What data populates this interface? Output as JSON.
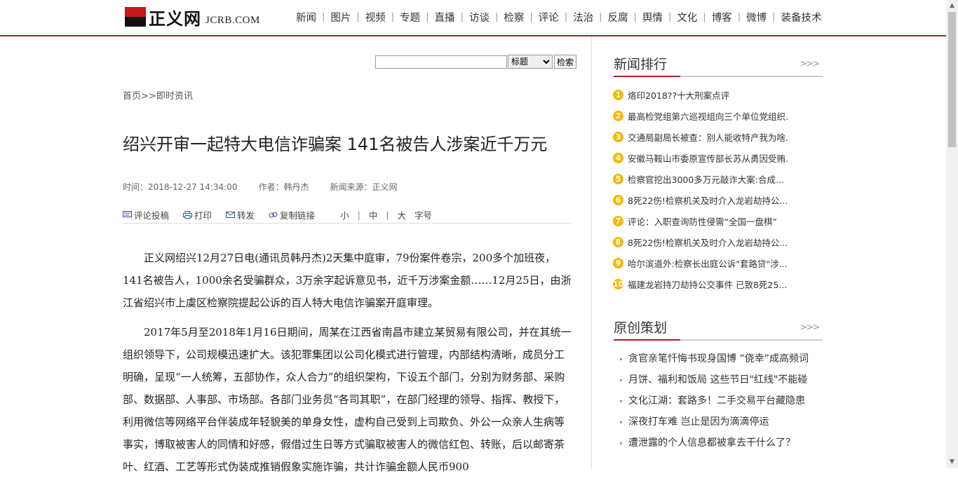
{
  "header": {
    "logo_cn": "正义网",
    "logo_en": "JCRB.COM",
    "nav": [
      "新闻",
      "图片",
      "视频",
      "专题",
      "直播",
      "访谈",
      "检察",
      "评论",
      "法治",
      "反腐",
      "舆情",
      "文化",
      "博客",
      "微博",
      "装备技术"
    ]
  },
  "search": {
    "input_value": "",
    "select_value": "标题",
    "button_label": "检索"
  },
  "breadcrumb": {
    "home": "首页",
    "sep": ">>",
    "current": "即时资讯"
  },
  "article": {
    "title": "绍兴开审一起特大电信诈骗案 141名被告人涉案近千万元",
    "time": "时间：2018-12-27 14:34:00",
    "author": "作者：韩丹杰",
    "source": "新闻来源：正义网",
    "tools": {
      "comment": "评论投稿",
      "print": "打印",
      "forward": "转发",
      "copy_link": "复制链接",
      "small": "小",
      "medium": "中",
      "large": "大",
      "font_size": "字号"
    },
    "paragraphs": [
      "正义网绍兴12月27日电(通讯员韩丹杰)2天集中庭审，79份案件卷宗，200多个加班夜，141名被告人，1000余名受骗群众，3万余字起诉意见书，近千万涉案金额……12月25日，由浙江省绍兴市上虞区检察院提起公诉的百人特大电信诈骗案开庭审理。",
      "2017年5月至2018年1月16日期间，周某在江西省南昌市建立某贸易有限公司，并在其统一组织领导下，公司规模迅速扩大。该犯罪集团以公司化模式进行管理，内部结构清晰，成员分工明确，呈现“一人统筹，五部协作，众人合力”的组织架构，下设五个部门，分别为财务部、采购部、数据部、人事部、市场部。各部门业务员“各司其职”，在部门经理的领导、指挥、教授下，利用微信等网络平台伴装成年轻貌美的单身女性，虚构自己受到上司欺负、外公一众亲人生病等事实，博取被害人的同情和好感，假借过生日等方式骗取被害人的微信红包、转账，后以邮寄茶叶、红酒、工艺等形式伪装成推销假象实施诈骗，共计诈骗金额人民币900"
    ]
  },
  "sidebar": {
    "rank_title": "新闻排行",
    "more": ">>>",
    "rank_items": [
      {
        "num": "1",
        "text": "烙印2018??十大刑案点评"
      },
      {
        "num": "2",
        "text": "最高检党组第六巡视组向三个单位党组织."
      },
      {
        "num": "3",
        "text": "交通局副局长被查：别人能收特产我为啥."
      },
      {
        "num": "4",
        "text": "安徽马鞍山市委原宣传部长苏从勇因受贿."
      },
      {
        "num": "5",
        "text": "检察官挖出3000多万元敲诈大案:合成..."
      },
      {
        "num": "6",
        "text": "8死22伤!检察机关及时介入龙岩劫持公..."
      },
      {
        "num": "7",
        "text": "评论：入职查询防性侵需“全国一盘棋”"
      },
      {
        "num": "8",
        "text": "8死22伤!检察机关及时介入龙岩劫持公..."
      },
      {
        "num": "9",
        "text": "哈尔滨道外:检察长出庭公诉\"套路贷\"涉..."
      },
      {
        "num": "10",
        "text": "福建龙岩持刀劫持公交事件 已致8死25..."
      }
    ],
    "orig_title": "原创策划",
    "orig_items": [
      "贪官亲笔忏悔书现身国博 “侥幸”成高频词",
      "月饼、福利和饭局 这些节日\"红线\"不能碰",
      "文化江湖：套路多！二手交易平台藏隐患",
      "深夜打车难 岂止是因为滴滴停运",
      "遭泄露的个人信息都被拿去干什么了？"
    ]
  },
  "colors": {
    "accent_red": "#b22222",
    "rank_badge": "#f5b800"
  }
}
